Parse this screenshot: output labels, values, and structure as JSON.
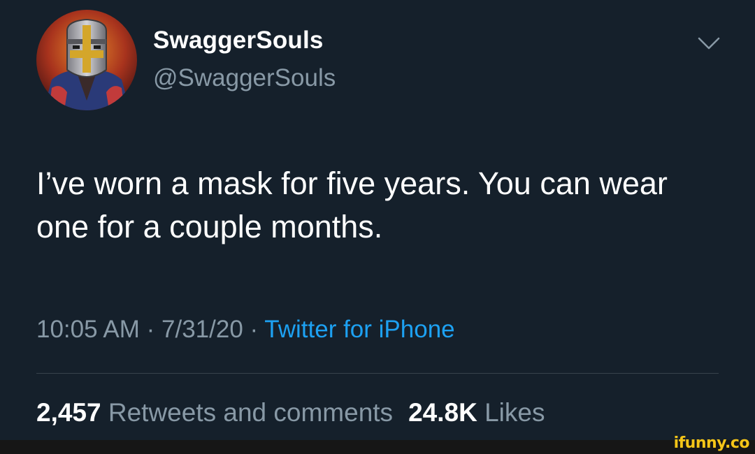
{
  "tweet": {
    "display_name": "SwaggerSouls",
    "handle": "@SwaggerSouls",
    "text": "I’ve worn a mask for five years. You can wear one for a couple months.",
    "time": "10:05 AM",
    "date": "7/31/20",
    "separator": "·",
    "source": "Twitter for iPhone",
    "retweets_count": "2,457",
    "retweets_label": "Retweets and comments",
    "likes_count": "24.8K",
    "likes_label": "Likes"
  },
  "colors": {
    "background": "#15202b",
    "secondary_text": "#8899a6",
    "link": "#1da1f2",
    "divider": "#38444d",
    "watermark": "#f5c518"
  },
  "icons": {
    "avatar": "knight-helmet-avatar",
    "menu": "chevron-down-icon"
  },
  "watermark": "ifunny.co"
}
